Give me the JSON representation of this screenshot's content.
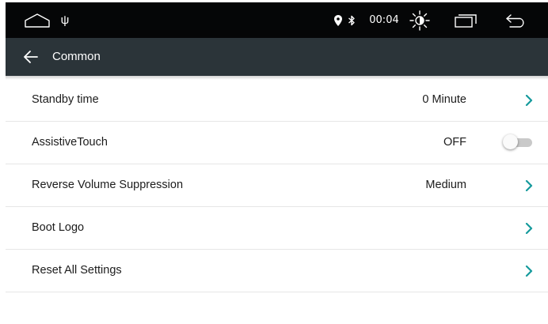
{
  "status_bar": {
    "home_icon": "home-icon",
    "usb_glyph": "ψ",
    "location_icon": "location-pin-icon",
    "bluetooth_glyph": "∦",
    "time": "00:04",
    "brightness_icon": "brightness-icon",
    "recents_icon": "recents-icon",
    "back_icon": "back-arrow-icon"
  },
  "title_bar": {
    "back_icon": "arrow-left-icon",
    "title": "Common"
  },
  "settings": [
    {
      "label": "Standby time",
      "value": "0 Minute",
      "control": "chevron"
    },
    {
      "label": "AssistiveTouch",
      "value": "OFF",
      "control": "toggle",
      "toggle_on": false
    },
    {
      "label": "Reverse Volume Suppression",
      "value": "Medium",
      "control": "chevron"
    },
    {
      "label": "Boot Logo",
      "value": "",
      "control": "chevron"
    },
    {
      "label": "Reset All Settings",
      "value": "",
      "control": "chevron"
    }
  ],
  "colors": {
    "status_bar_bg": "#050607",
    "title_bar_bg": "#2b3439",
    "accent_teal": "#159a9c",
    "toggle_off_track": "#c9c9c9"
  }
}
